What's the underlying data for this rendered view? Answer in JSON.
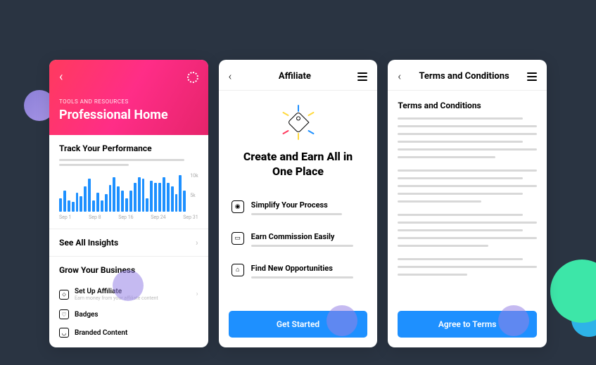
{
  "card1": {
    "eyebrow": "TOOLS AND RESOURCES",
    "title": "Professional Home",
    "track_title": "Track Your Performance",
    "see_all": "See All Insights",
    "grow_title": "Grow Your Business",
    "items": [
      {
        "label": "Set Up Affiliate",
        "sub": "Earn money from your affiliate content"
      },
      {
        "label": "Badges",
        "sub": ""
      },
      {
        "label": "Branded Content",
        "sub": ""
      }
    ],
    "chart_x": [
      "Sep 1",
      "Sep 8",
      "Sep 16",
      "Sep 24",
      "Sep 31"
    ],
    "chart_y": [
      "10k",
      "5k",
      ""
    ]
  },
  "card2": {
    "header": "Affiliate",
    "title": "Create and Earn All in One Place",
    "items": [
      {
        "label": "Simplify Your Process"
      },
      {
        "label": "Earn Commission Easily"
      },
      {
        "label": "Find New Opportunities"
      }
    ],
    "cta": "Get Started"
  },
  "card3": {
    "header": "Terms and Conditions",
    "title": "Terms and Conditions",
    "cta": "Agree to Terms"
  },
  "chart_data": {
    "type": "bar",
    "title": "Track Your Performance",
    "xlabel": "",
    "ylabel": "",
    "categories": [
      "Sep 1",
      "",
      "",
      "",
      "",
      "",
      "",
      "Sep 8",
      "",
      "",
      "",
      "",
      "",
      "",
      "",
      "Sep 16",
      "",
      "",
      "",
      "",
      "",
      "",
      "",
      "Sep 24",
      "",
      "",
      "",
      "",
      "",
      "",
      "Sep 31"
    ],
    "values": [
      3500,
      5500,
      3000,
      2500,
      5000,
      4000,
      6500,
      8500,
      3000,
      5000,
      3000,
      4500,
      7000,
      9000,
      6500,
      5500,
      3500,
      5500,
      7500,
      9000,
      8500,
      3500,
      8000,
      7500,
      7500,
      9000,
      7500,
      6500,
      4500,
      9500,
      5500
    ],
    "ylim": [
      0,
      10000
    ],
    "yticks": [
      5000,
      10000
    ]
  }
}
